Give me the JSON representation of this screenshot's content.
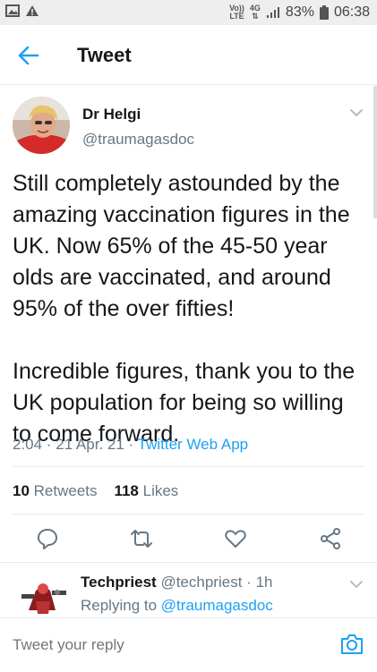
{
  "status_bar": {
    "volte": "Vo))",
    "lte": "LTE",
    "network": "4G",
    "battery": "83%",
    "time": "06:38"
  },
  "header": {
    "title": "Tweet"
  },
  "tweet": {
    "author_name": "Dr Helgi",
    "author_handle": "@traumagasdoc",
    "text": "Still completely astounded by the amazing vaccination figures in the UK.  Now 65% of the 45-50 year olds are vaccinated, and around 95% of the over fifties!\n\nIncredible figures, thank you to the UK population for being so willing to come forward.",
    "time": "2:04",
    "date": "21 Apr. 21",
    "source": "Twitter Web App",
    "retweets_count": "10",
    "retweets_label": "Retweets",
    "likes_count": "118",
    "likes_label": "Likes"
  },
  "reply": {
    "author_name": "Techpriest",
    "author_handle": "@techpriest",
    "age": "1h",
    "replying_label": "Replying to",
    "replying_to": "@traumagasdoc"
  },
  "composer": {
    "placeholder": "Tweet your reply"
  },
  "colors": {
    "accent": "#1da1f2",
    "secondary_text": "#657786",
    "divider": "#e6ecf0"
  }
}
